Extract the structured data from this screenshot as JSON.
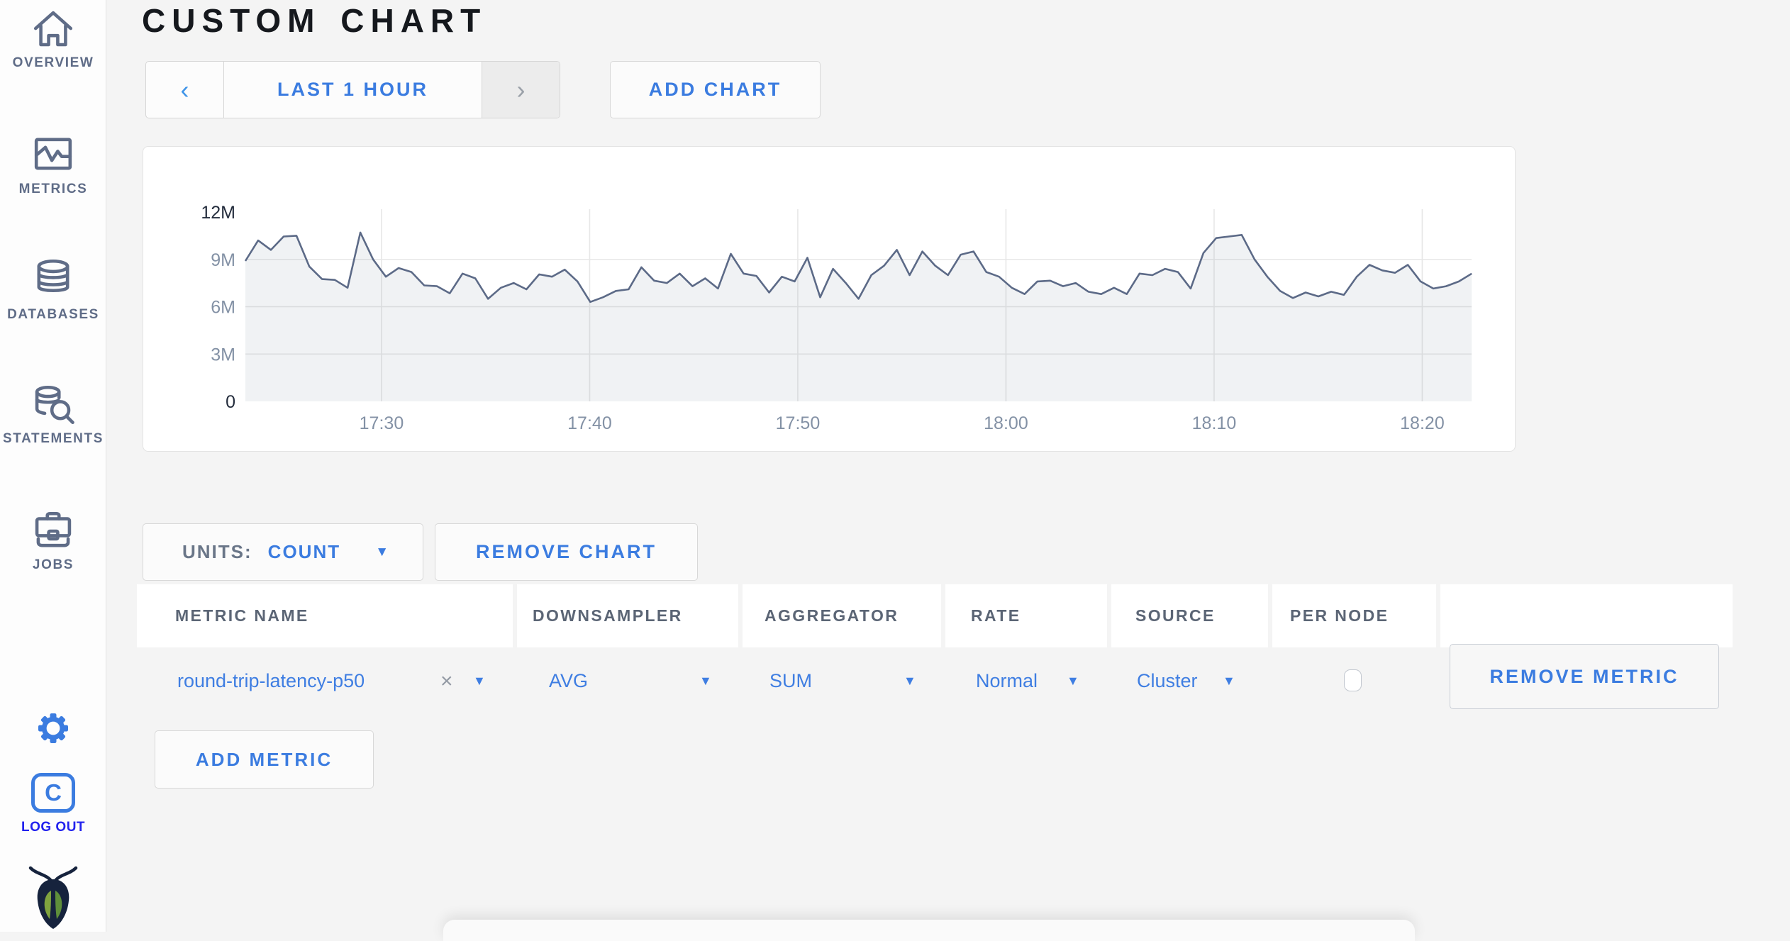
{
  "header": {
    "title": "CUSTOM CHART"
  },
  "toolbar": {
    "prev_arrow": "‹",
    "time_window_label": "LAST 1 HOUR",
    "next_arrow": "›",
    "add_chart_label": "ADD CHART"
  },
  "sidebar": {
    "items": [
      {
        "label": "OVERVIEW",
        "icon": "home-icon"
      },
      {
        "label": "METRICS",
        "icon": "metrics-graph-icon"
      },
      {
        "label": "DATABASES",
        "icon": "database-icon"
      },
      {
        "label": "STATEMENTS",
        "icon": "database-search-icon"
      },
      {
        "label": "JOBS",
        "icon": "briefcase-icon"
      }
    ],
    "logo_letter": "C",
    "logout_label": "LOG OUT"
  },
  "chart_controls": {
    "units_label": "UNITS:",
    "units_value": "COUNT",
    "remove_chart_label": "REMOVE CHART",
    "add_metric_label": "ADD METRIC"
  },
  "metrics_table": {
    "columns": [
      "METRIC NAME",
      "DOWNSAMPLER",
      "AGGREGATOR",
      "RATE",
      "SOURCE",
      "PER NODE"
    ],
    "rows": [
      {
        "metric_name": "round-trip-latency-p50",
        "clear_icon": "×",
        "downsampler": "AVG",
        "aggregator": "SUM",
        "rate": "Normal",
        "source": "Cluster",
        "per_node_checked": false,
        "remove_label": "REMOVE METRIC"
      }
    ]
  },
  "chart_data": {
    "type": "area",
    "series_name": "round-trip-latency-p50",
    "units": "COUNT",
    "ylim_millions": [
      0,
      12
    ],
    "y_ticks": [
      {
        "label": "0",
        "value": 0,
        "emphasized": true
      },
      {
        "label": "3M",
        "value": 3,
        "emphasized": false
      },
      {
        "label": "6M",
        "value": 6,
        "emphasized": false
      },
      {
        "label": "9M",
        "value": 9,
        "emphasized": false
      },
      {
        "label": "12M",
        "value": 12,
        "emphasized": true
      }
    ],
    "x_ticks": [
      {
        "label": "17:30",
        "minute": 0
      },
      {
        "label": "17:40",
        "minute": 10
      },
      {
        "label": "17:50",
        "minute": 20
      },
      {
        "label": "18:00",
        "minute": 30
      },
      {
        "label": "18:10",
        "minute": 40
      },
      {
        "label": "18:20",
        "minute": 50
      }
    ],
    "x_start_minute": -6.54,
    "x_step_minute": 0.6137,
    "values_millions": [
      8.9,
      10.2,
      9.6,
      10.45,
      10.5,
      8.55,
      7.75,
      7.7,
      7.2,
      10.7,
      9.0,
      7.9,
      8.45,
      8.2,
      7.35,
      7.3,
      6.85,
      8.1,
      7.8,
      6.5,
      7.2,
      7.5,
      7.1,
      8.05,
      7.9,
      8.35,
      7.6,
      6.3,
      6.6,
      7.0,
      7.1,
      8.5,
      7.65,
      7.5,
      8.1,
      7.3,
      7.8,
      7.15,
      9.35,
      8.1,
      7.95,
      6.9,
      7.9,
      7.6,
      9.1,
      6.6,
      8.4,
      7.5,
      6.5,
      8.0,
      8.6,
      9.6,
      8.0,
      9.5,
      8.6,
      8.0,
      9.3,
      9.5,
      8.2,
      7.9,
      7.2,
      6.8,
      7.6,
      7.65,
      7.3,
      7.5,
      6.95,
      6.8,
      7.2,
      6.8,
      8.1,
      8.0,
      8.4,
      8.2,
      7.15,
      9.4,
      10.35,
      10.45,
      10.55,
      9.0,
      7.9,
      7.0,
      6.55,
      6.9,
      6.65,
      6.95,
      6.75,
      7.9,
      8.65,
      8.3,
      8.15,
      8.65,
      7.6,
      7.15,
      7.3,
      7.6,
      8.1
    ]
  },
  "colors": {
    "accent_blue": "#3b7ce0",
    "slate_text": "#5f6c87",
    "logout_blue": "#2222ee",
    "chart_line": "#5c6a87",
    "chart_fill": "rgba(92,106,135,0.09)",
    "grid_line": "#e7e7e7",
    "tick_dark": "#232c3c",
    "tick_light": "#8391a5",
    "page_bg": "#f4f4f4"
  }
}
